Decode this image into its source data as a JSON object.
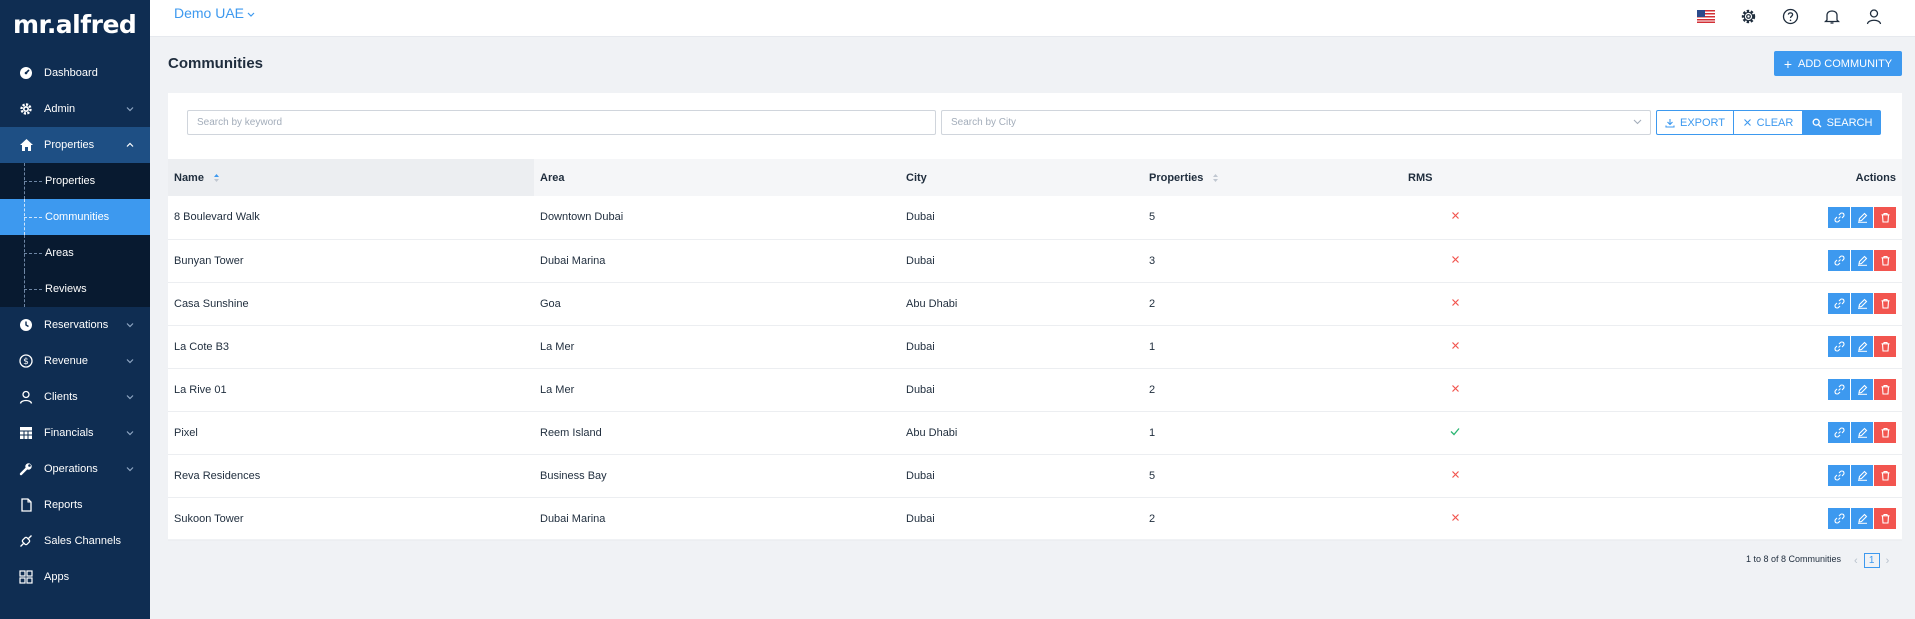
{
  "app": {
    "logo": "mr.alfred"
  },
  "topbar": {
    "org_name": "Demo UAE",
    "flag": "us-flag",
    "icons": [
      "gear-icon",
      "help-icon",
      "bell-icon",
      "user-icon"
    ]
  },
  "sidebar": {
    "items": [
      {
        "label": "Dashboard",
        "icon": "dashboard-icon"
      },
      {
        "label": "Admin",
        "icon": "gear-icon"
      },
      {
        "label": "Properties",
        "icon": "home-icon"
      },
      {
        "label": "Reservations",
        "icon": "clock-icon"
      },
      {
        "label": "Revenue",
        "icon": "dollar-icon"
      },
      {
        "label": "Clients",
        "icon": "user-icon"
      },
      {
        "label": "Financials",
        "icon": "grid-icon"
      },
      {
        "label": "Operations",
        "icon": "wrench-icon"
      },
      {
        "label": "Reports",
        "icon": "document-icon"
      },
      {
        "label": "Sales Channels",
        "icon": "plug-icon"
      },
      {
        "label": "Apps",
        "icon": "apps-icon"
      }
    ],
    "sub_items": [
      {
        "label": "Properties"
      },
      {
        "label": "Communities"
      },
      {
        "label": "Areas"
      },
      {
        "label": "Reviews"
      }
    ]
  },
  "page": {
    "title": "Communities",
    "add_button": "ADD COMMUNITY"
  },
  "filters": {
    "keyword_placeholder": "Search by keyword",
    "city_placeholder": "Search by City",
    "export_label": "EXPORT",
    "clear_label": "CLEAR",
    "search_label": "SEARCH"
  },
  "table": {
    "columns": [
      "Name",
      "Area",
      "City",
      "Properties",
      "RMS",
      "Actions"
    ],
    "rows": [
      {
        "name": "8 Boulevard Walk",
        "area": "Downtown Dubai",
        "city": "Dubai",
        "properties": "5",
        "rms": false
      },
      {
        "name": "Bunyan Tower",
        "area": "Dubai Marina",
        "city": "Dubai",
        "properties": "3",
        "rms": false
      },
      {
        "name": "Casa Sunshine",
        "area": "Goa",
        "city": "Abu Dhabi",
        "properties": "2",
        "rms": false
      },
      {
        "name": "La Cote B3",
        "area": "La Mer",
        "city": "Dubai",
        "properties": "1",
        "rms": false
      },
      {
        "name": "La Rive 01",
        "area": "La Mer",
        "city": "Dubai",
        "properties": "2",
        "rms": false
      },
      {
        "name": "Pixel",
        "area": "Reem Island",
        "city": "Abu Dhabi",
        "properties": "1",
        "rms": true
      },
      {
        "name": "Reva Residences",
        "area": "Business Bay",
        "city": "Dubai",
        "properties": "5",
        "rms": false
      },
      {
        "name": "Sukoon Tower",
        "area": "Dubai Marina",
        "city": "Dubai",
        "properties": "2",
        "rms": false
      }
    ]
  },
  "pagination": {
    "summary": "1 to 8 of 8 Communities",
    "current_page": "1"
  },
  "colors": {
    "sidebar": "#0f2d52",
    "accent": "#3d99ef",
    "danger": "#f2554f",
    "success": "#2bb673"
  }
}
